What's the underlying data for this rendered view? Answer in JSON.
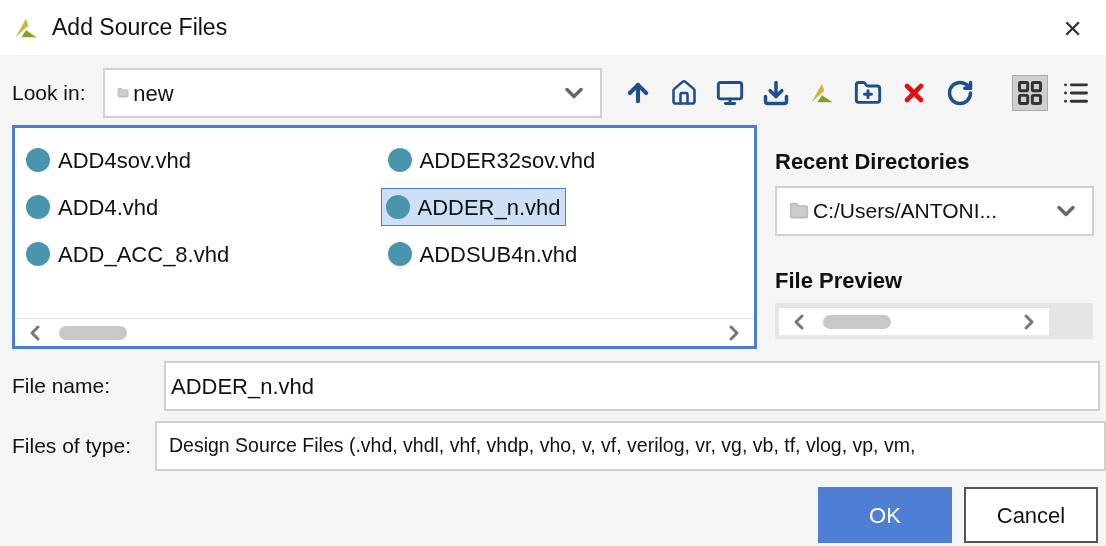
{
  "window": {
    "title": "Add Source Files",
    "close": "×"
  },
  "look_in": {
    "label": "Look in:",
    "value": "new"
  },
  "toolbar": [
    {
      "kind": "up",
      "selected": false
    },
    {
      "kind": "home",
      "selected": false
    },
    {
      "kind": "desktop",
      "selected": false
    },
    {
      "kind": "download",
      "selected": false
    },
    {
      "kind": "logo",
      "selected": false
    },
    {
      "kind": "newfolder",
      "selected": false
    },
    {
      "kind": "delete",
      "selected": false
    },
    {
      "kind": "refresh",
      "selected": false
    },
    {
      "kind": "grid",
      "selected": true
    },
    {
      "kind": "list",
      "selected": false
    }
  ],
  "files": [
    {
      "name": "ADD4sov.vhd",
      "selected": false
    },
    {
      "name": "ADDER32sov.vhd",
      "selected": false
    },
    {
      "name": "ADD4.vhd",
      "selected": false
    },
    {
      "name": "ADDER_n.vhd",
      "selected": true
    },
    {
      "name": "ADD_ACC_8.vhd",
      "selected": false
    },
    {
      "name": "ADDSUB4n.vhd",
      "selected": false
    }
  ],
  "recent_directories": {
    "title": "Recent Directories",
    "value": "C:/Users/ANTONI..."
  },
  "file_preview": {
    "title": "File Preview"
  },
  "file_name": {
    "label": "File name:",
    "value": "ADDER_n.vhd"
  },
  "files_of_type": {
    "label": "Files of type:",
    "value": "Design Source Files (.vhd, vhdl, vhf, vhdp, vho, v, vf, verilog, vr, vg, vb, tf, vlog, vp, vm,"
  },
  "buttons": [
    {
      "label": "OK",
      "kind": "primary"
    },
    {
      "label": "Cancel",
      "kind": "secondary"
    }
  ]
}
